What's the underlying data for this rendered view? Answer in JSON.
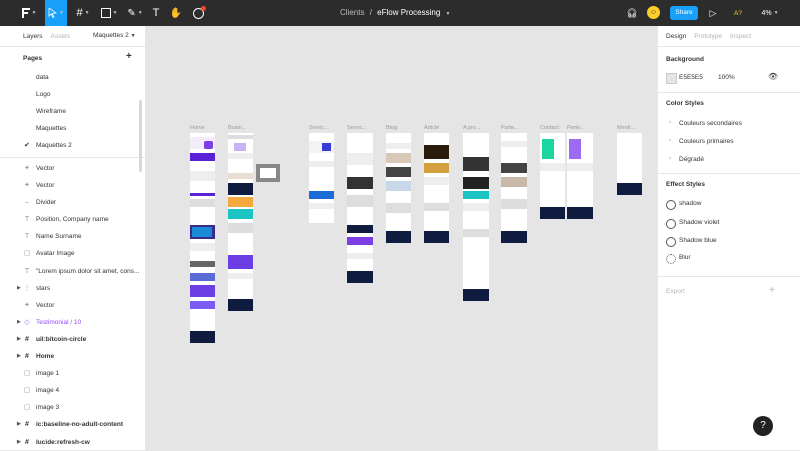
{
  "toolbar": {
    "breadcrumb_project": "Clients",
    "breadcrumb_sep": "/",
    "file_name": "eFlow Processing",
    "share_label": "Share",
    "avatar_initial": "☺",
    "ai_label": "A?",
    "zoom": "4%"
  },
  "left_panel": {
    "tab_layers": "Layers",
    "tab_assets": "Assets",
    "page_selector": "Maquettes 2",
    "pages_title": "Pages",
    "pages": [
      "data",
      "Logo",
      "Wireframe",
      "Maquettes",
      "Maquettes 2"
    ],
    "layers": [
      {
        "icon": "vector-icon",
        "glyph": "✦",
        "label": "Vector"
      },
      {
        "icon": "vector-icon",
        "glyph": "✦",
        "label": "Vector"
      },
      {
        "icon": "divider-icon",
        "glyph": "–",
        "label": "Divider"
      },
      {
        "icon": "text-icon",
        "glyph": "T",
        "label": "Position, Company name"
      },
      {
        "icon": "text-icon",
        "glyph": "T",
        "label": "Name Surname"
      },
      {
        "icon": "image-icon",
        "glyph": "▢",
        "label": "Avatar Image"
      },
      {
        "icon": "text-icon",
        "glyph": "T",
        "label": "\"Lorem ipsum dolor sit amet, cons..."
      },
      {
        "icon": "component-icon",
        "glyph": "⋮",
        "label": "stars"
      },
      {
        "icon": "vector-icon",
        "glyph": "✦",
        "label": "Vector"
      },
      {
        "icon": "instance-icon",
        "glyph": "◇",
        "label": "Testimonial / 10"
      },
      {
        "icon": "frame-icon",
        "glyph": "#",
        "label": "uil:bitcoin-circle"
      },
      {
        "icon": "frame-icon",
        "glyph": "#",
        "label": "Home"
      },
      {
        "icon": "image-icon",
        "glyph": "▢",
        "label": "image 1"
      },
      {
        "icon": "image-icon",
        "glyph": "▢",
        "label": "image 4"
      },
      {
        "icon": "image-icon",
        "glyph": "▢",
        "label": "image 3"
      },
      {
        "icon": "frame-icon",
        "glyph": "#",
        "label": "ic:baseline-no-adult-content"
      },
      {
        "icon": "frame-icon",
        "glyph": "#",
        "label": "lucide:refresh-cw"
      }
    ]
  },
  "canvas": {
    "frame_labels": [
      "Home",
      "Busin...",
      "Servic...",
      "Servic...",
      "Blog",
      "Article",
      "A pro...",
      "Parte...",
      "Contact",
      "Parte...",
      "Menti..."
    ]
  },
  "right_panel": {
    "tab_design": "Design",
    "tab_prototype": "Prototype",
    "tab_inspect": "Inspect",
    "background_title": "Background",
    "background_hex": "E5E5E5",
    "background_opacity": "100%",
    "color_styles_title": "Color Styles",
    "color_styles": [
      "Couleurs secondaires",
      "Couleurs primaires",
      "Dégradé"
    ],
    "effect_styles_title": "Effect Styles",
    "effect_styles": [
      "shadow",
      "Shadow violet",
      "Shadow blue",
      "Blur"
    ],
    "export_title": "Export"
  },
  "help_label": "?"
}
